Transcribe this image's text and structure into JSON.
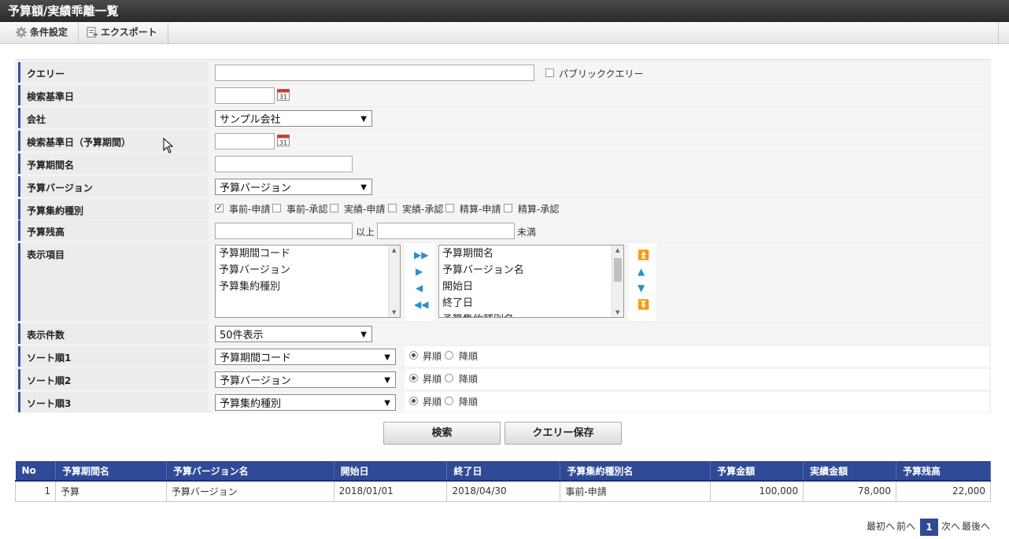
{
  "title": "予算額/実績乖離一覧",
  "toolbar": {
    "settings": "条件設定",
    "export": "エクスポート"
  },
  "form": {
    "query": {
      "label": "クエリー",
      "value": "",
      "public_label": "パブリッククエリー"
    },
    "base_date": {
      "label": "検索基準日",
      "value": ""
    },
    "company": {
      "label": "会社",
      "value": "サンプル会社"
    },
    "base_date_period": {
      "label": "検索基準日（予算期間）",
      "value": ""
    },
    "period_name": {
      "label": "予算期間名",
      "value": ""
    },
    "version": {
      "label": "予算バージョン",
      "value": "予算バージョン"
    },
    "aggregation": {
      "label": "予算集約種別",
      "options": [
        {
          "label": "事前-申請",
          "checked": true
        },
        {
          "label": "事前-承認",
          "checked": false
        },
        {
          "label": "実績-申請",
          "checked": false
        },
        {
          "label": "実績-承認",
          "checked": false
        },
        {
          "label": "精算-申請",
          "checked": false
        },
        {
          "label": "精算-承認",
          "checked": false
        }
      ]
    },
    "balance": {
      "label": "予算残高",
      "from": "",
      "from_suffix": "以上",
      "to": "",
      "to_suffix": "未満"
    },
    "display_items": {
      "label": "表示項目",
      "available": [
        "予算期間コード",
        "予算バージョン",
        "予算集約種別"
      ],
      "selected": [
        "予算期間名",
        "予算バージョン名",
        "開始日",
        "終了日",
        "予算集約種別名"
      ]
    },
    "count": {
      "label": "表示件数",
      "value": "50件表示"
    },
    "sort1": {
      "label": "ソート順1",
      "value": "予算期間コード",
      "asc": "昇順",
      "desc": "降順"
    },
    "sort2": {
      "label": "ソート順2",
      "value": "予算バージョン",
      "asc": "昇順",
      "desc": "降順"
    },
    "sort3": {
      "label": "ソート順3",
      "value": "予算集約種別",
      "asc": "昇順",
      "desc": "降順"
    }
  },
  "buttons": {
    "search": "検索",
    "save_query": "クエリー保存"
  },
  "table": {
    "headers": [
      "No",
      "予算期間名",
      "予算バージョン名",
      "開始日",
      "終了日",
      "予算集約種別名",
      "予算金額",
      "実績金額",
      "予算残高"
    ],
    "rows": [
      [
        "1",
        "予算",
        "予算バージョン",
        "2018/01/01",
        "2018/04/30",
        "事前-申請",
        "100,000",
        "78,000",
        "22,000"
      ]
    ]
  },
  "pager": {
    "first": "最初へ",
    "prev": "前へ",
    "current": "1",
    "next": "次へ",
    "last": "最後へ"
  },
  "colors": {
    "accent": "#2f4a96",
    "titlebar": "#333333"
  }
}
